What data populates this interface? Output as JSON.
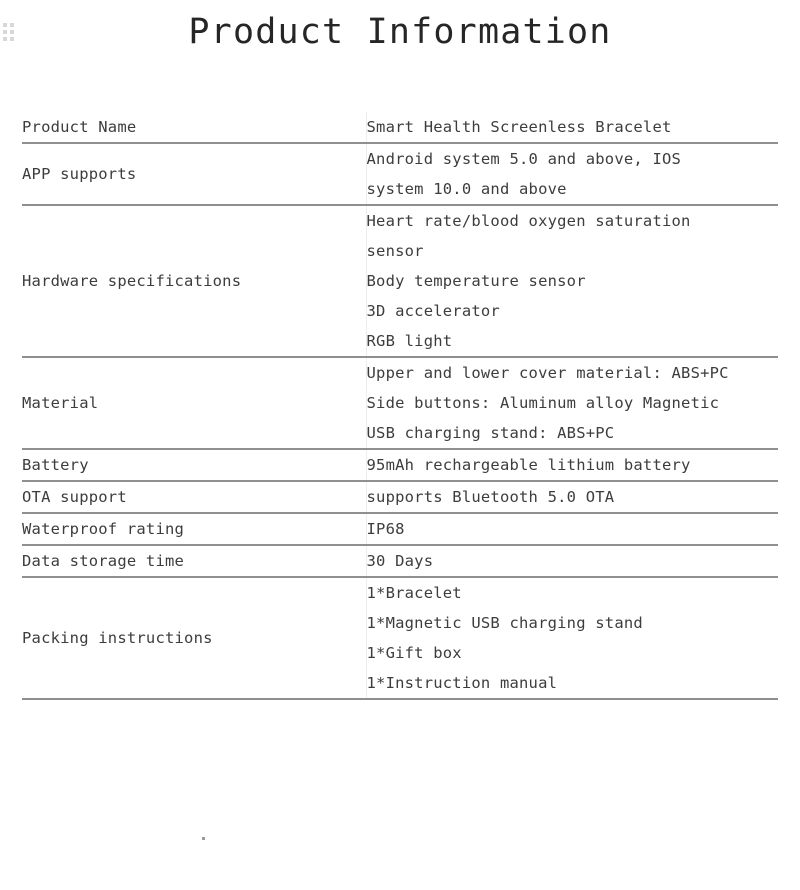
{
  "header": {
    "title": "Product Information",
    "drag_handle_icon": "drag-handle-dots-icon"
  },
  "table": {
    "rows": [
      {
        "label": "Product Name",
        "values": [
          "Smart Health Screenless Bracelet"
        ]
      },
      {
        "label": "APP supports",
        "values": [
          "Android system 5.0 and above, IOS",
          "system 10.0 and above"
        ]
      },
      {
        "label": "Hardware specifications",
        "values": [
          "Heart rate/blood oxygen saturation",
          "sensor",
          "Body temperature sensor",
          "3D accelerator",
          "RGB light"
        ]
      },
      {
        "label": "Material",
        "values": [
          "Upper and lower cover material: ABS+PC",
          "Side buttons: Aluminum alloy Magnetic",
          "USB charging stand: ABS+PC"
        ]
      },
      {
        "label": "Battery",
        "values": [
          "95mAh rechargeable lithium battery"
        ]
      },
      {
        "label": "OTA support",
        "values": [
          "supports Bluetooth 5.0 OTA"
        ]
      },
      {
        "label": "Waterproof rating",
        "values": [
          "IP68"
        ]
      },
      {
        "label": "Data storage time",
        "values": [
          "30 Days"
        ]
      },
      {
        "label": "Packing instructions",
        "values": [
          "1*Bracelet",
          "1*Magnetic USB charging stand",
          "1*Gift box",
          "1*Instruction manual"
        ]
      }
    ]
  },
  "colors": {
    "background": "#ffffff",
    "text": "#3d3d3d",
    "title_text": "#262626",
    "rule": "#8f8f8f",
    "column_divider": "#ededed",
    "handle_dot": "#d8d8d8"
  }
}
